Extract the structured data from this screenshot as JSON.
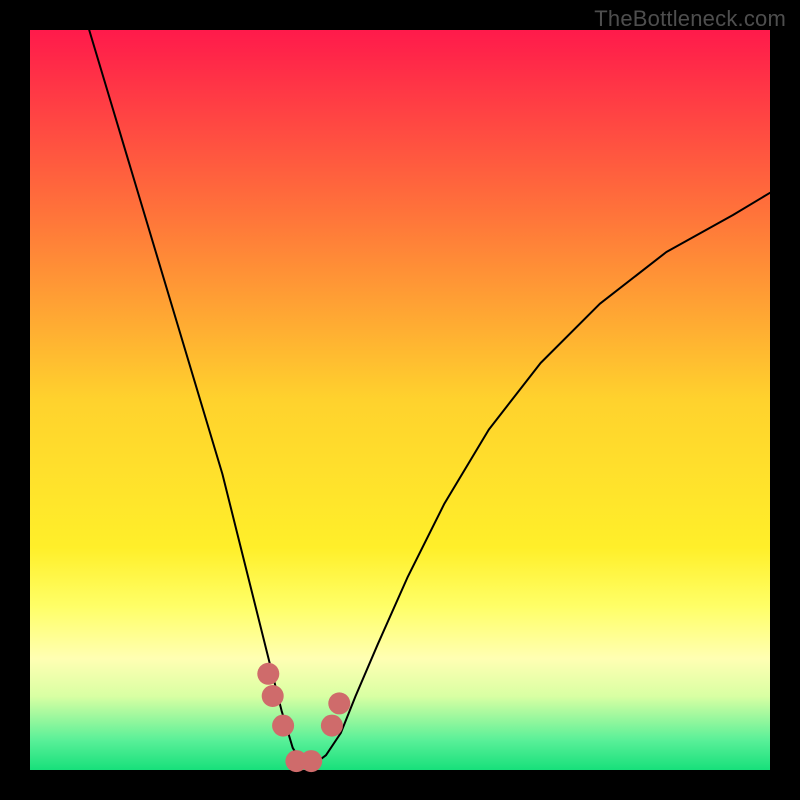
{
  "watermark": "TheBottleneck.com",
  "chart_data": {
    "type": "line",
    "title": "",
    "xlabel": "",
    "ylabel": "",
    "xlim": [
      0,
      100
    ],
    "ylim": [
      0,
      100
    ],
    "grid": false,
    "legend": false,
    "gradient_stops": [
      {
        "offset": 0.0,
        "color": "#ff1a4b"
      },
      {
        "offset": 0.25,
        "color": "#ff743a"
      },
      {
        "offset": 0.5,
        "color": "#ffd22d"
      },
      {
        "offset": 0.7,
        "color": "#ffef2a"
      },
      {
        "offset": 0.78,
        "color": "#ffff68"
      },
      {
        "offset": 0.85,
        "color": "#ffffb3"
      },
      {
        "offset": 0.9,
        "color": "#d9ffa3"
      },
      {
        "offset": 0.96,
        "color": "#59f098"
      },
      {
        "offset": 1.0,
        "color": "#17e07b"
      }
    ],
    "series": [
      {
        "name": "bottleneck-curve",
        "color": "#000000",
        "stroke_width": 2,
        "x": [
          8,
          11,
          14,
          17,
          20,
          23,
          26,
          28,
          30,
          32,
          34,
          35.5,
          37,
          38,
          40,
          42,
          44,
          47,
          51,
          56,
          62,
          69,
          77,
          86,
          95,
          100
        ],
        "y": [
          100,
          90,
          80,
          70,
          60,
          50,
          40,
          32,
          24,
          16,
          8,
          3,
          0.5,
          0.5,
          2,
          5,
          10,
          17,
          26,
          36,
          46,
          55,
          63,
          70,
          75,
          78
        ]
      },
      {
        "name": "highlight-dots",
        "color": "#cf6b6b",
        "type": "scatter",
        "marker_radius": 11,
        "x": [
          32.2,
          32.8,
          34.2,
          36.0,
          38.0,
          40.8,
          41.8
        ],
        "y": [
          13.0,
          10.0,
          6.0,
          1.2,
          1.2,
          6.0,
          9.0
        ]
      }
    ],
    "frame": {
      "margin": 30,
      "inner_size": 740,
      "outer_size": 800
    }
  }
}
